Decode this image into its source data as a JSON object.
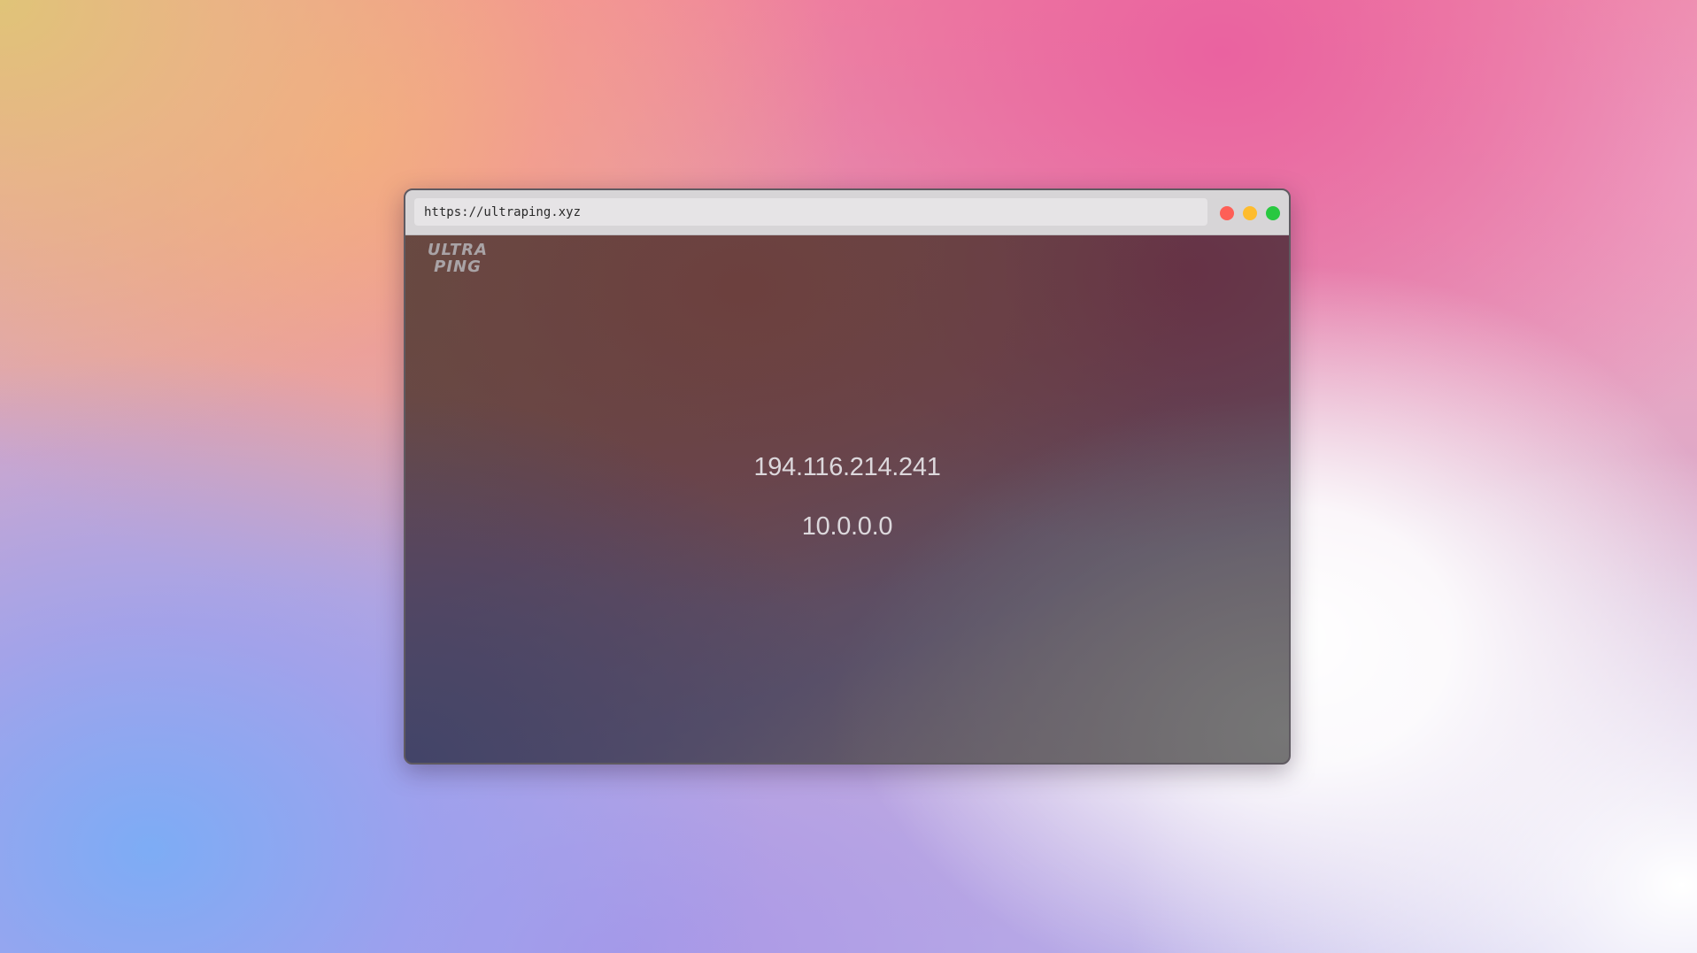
{
  "browser": {
    "url": "https://ultraping.xyz",
    "window_controls": [
      {
        "name": "close",
        "color": "#fe5f57"
      },
      {
        "name": "minimize",
        "color": "#febc2e"
      },
      {
        "name": "maximize",
        "color": "#28c840"
      }
    ]
  },
  "page": {
    "logo": {
      "line1": "ULTRA",
      "line2": "PING"
    },
    "public_ip": "194.116.214.241",
    "local_ip": "10.0.0.0"
  }
}
